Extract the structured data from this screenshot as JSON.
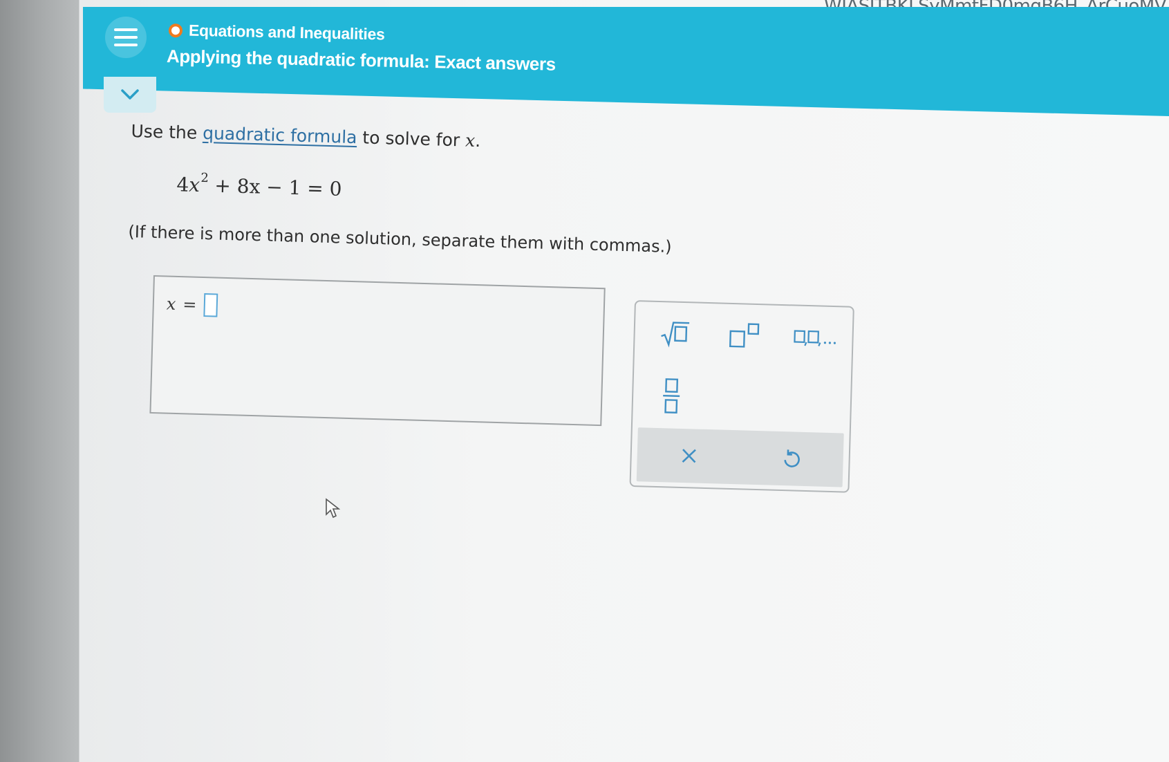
{
  "browser": {
    "url_fragment": "WIASITBKLSyMmtFD0mgB6H_ArCuoMV"
  },
  "header": {
    "topic": "Equations and Inequalities",
    "lesson_title": "Applying the quadratic formula: Exact answers",
    "menu_icon": "hamburger-menu-icon",
    "collapse_icon": "chevron-down-icon",
    "brand_color": "#22b7d8",
    "topic_dot_color": "#f07a1e"
  },
  "problem": {
    "prompt_before": "Use the ",
    "prompt_link": "quadratic formula",
    "prompt_after": " to solve for ",
    "prompt_var": "x",
    "prompt_end": ".",
    "equation": {
      "coef_a": "4",
      "var": "x",
      "exp": "2",
      "rest": " + 8x − 1 = 0"
    },
    "instruction": "(If there is more than one solution, separate them with commas.)"
  },
  "answer": {
    "lhs_var": "x",
    "equals": "=",
    "value": "",
    "slot_color": "#5aa8d8"
  },
  "keypad": {
    "keys": [
      {
        "name": "square-root",
        "icon": "square-root-icon"
      },
      {
        "name": "superscript",
        "icon": "superscript-icon"
      },
      {
        "name": "list",
        "icon": "comma-list-icon"
      },
      {
        "name": "fraction",
        "icon": "fraction-icon"
      }
    ],
    "actions": [
      {
        "name": "clear",
        "icon": "close-icon"
      },
      {
        "name": "undo",
        "icon": "undo-icon"
      }
    ],
    "icon_color": "#3f8fc4"
  }
}
